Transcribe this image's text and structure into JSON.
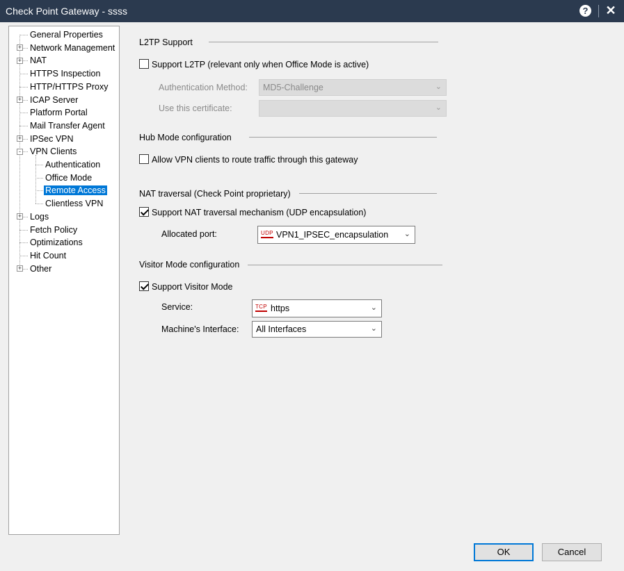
{
  "window": {
    "title": "Check Point Gateway - ssss",
    "help_glyph": "?",
    "close_glyph": "✕"
  },
  "tree": {
    "items": [
      {
        "label": "General Properties",
        "level": 0,
        "expander": false
      },
      {
        "label": "Network Management",
        "level": 0,
        "expander": "+"
      },
      {
        "label": "NAT",
        "level": 0,
        "expander": "+"
      },
      {
        "label": "HTTPS Inspection",
        "level": 0,
        "expander": false
      },
      {
        "label": "HTTP/HTTPS Proxy",
        "level": 0,
        "expander": false
      },
      {
        "label": "ICAP Server",
        "level": 0,
        "expander": "+"
      },
      {
        "label": "Platform Portal",
        "level": 0,
        "expander": false
      },
      {
        "label": "Mail Transfer Agent",
        "level": 0,
        "expander": false
      },
      {
        "label": "IPSec VPN",
        "level": 0,
        "expander": "+"
      },
      {
        "label": "VPN Clients",
        "level": 0,
        "expander": "-"
      },
      {
        "label": "Authentication",
        "level": 1,
        "expander": false
      },
      {
        "label": "Office Mode",
        "level": 1,
        "expander": false
      },
      {
        "label": "Remote Access",
        "level": 1,
        "expander": false,
        "selected": true
      },
      {
        "label": "Clientless VPN",
        "level": 1,
        "expander": false
      },
      {
        "label": "Logs",
        "level": 0,
        "expander": "+"
      },
      {
        "label": "Fetch Policy",
        "level": 0,
        "expander": false
      },
      {
        "label": "Optimizations",
        "level": 0,
        "expander": false
      },
      {
        "label": "Hit Count",
        "level": 0,
        "expander": false
      },
      {
        "label": "Other",
        "level": 0,
        "expander": "+"
      }
    ]
  },
  "l2tp": {
    "section_title": "L2TP Support",
    "support_label": "Support L2TP (relevant only when Office Mode is active)",
    "support_checked": false,
    "auth_method_label": "Authentication Method:",
    "auth_method_value": "MD5-Challenge",
    "certificate_label": "Use this certificate:",
    "certificate_value": ""
  },
  "hub_mode": {
    "section_title": "Hub Mode configuration",
    "allow_label": "Allow VPN clients to route traffic through this gateway",
    "allow_checked": false
  },
  "nat_traversal": {
    "section_title": "NAT traversal (Check Point proprietary)",
    "support_label": "Support NAT traversal mechanism (UDP encapsulation)",
    "support_checked": true,
    "port_label": "Allocated port:",
    "port_protocol": "UDP",
    "port_value": "VPN1_IPSEC_encapsulation"
  },
  "visitor_mode": {
    "section_title": "Visitor Mode configuration",
    "support_label": "Support Visitor Mode",
    "support_checked": true,
    "service_label": "Service:",
    "service_protocol": "TCP",
    "service_value": "https",
    "interface_label": "Machine's Interface:",
    "interface_value": "All Interfaces"
  },
  "buttons": {
    "ok": "OK",
    "cancel": "Cancel"
  },
  "icons": {
    "dropdown": "chevron-down-icon",
    "checkbox": "checkbox"
  }
}
